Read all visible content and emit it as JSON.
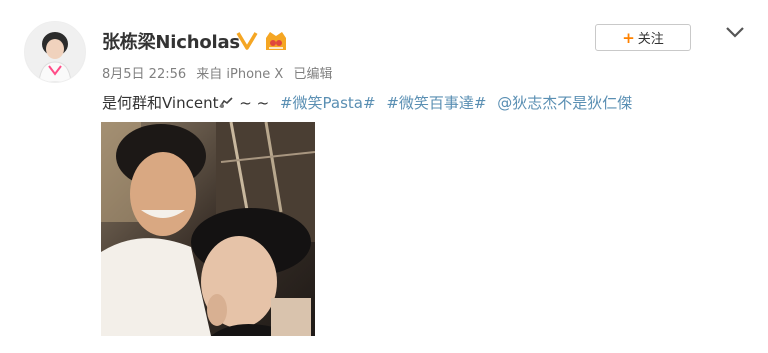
{
  "user": {
    "name": "张栋梁Nicholas",
    "verified_icon": "verified-v-icon",
    "badge_icon": "fan-badge-icon"
  },
  "meta": {
    "date": "8月5日 22:56",
    "source": "来自 iPhone X",
    "edited": "已编辑"
  },
  "actions": {
    "follow_plus": "+",
    "follow_label": "关注",
    "menu_icon": "chevron-down-icon"
  },
  "post": {
    "text": "是何群和Vincent",
    "emoji_icon": "hand-wave-icon",
    "tilde": " ~ ~",
    "tags": [
      "#微笑Pasta#",
      "#微笑百事達#"
    ],
    "mention": "@狄志杰不是狄仁傑"
  },
  "colors": {
    "link": "#5a8fb3",
    "accent": "#ff8200",
    "verified": "#f5a623"
  }
}
